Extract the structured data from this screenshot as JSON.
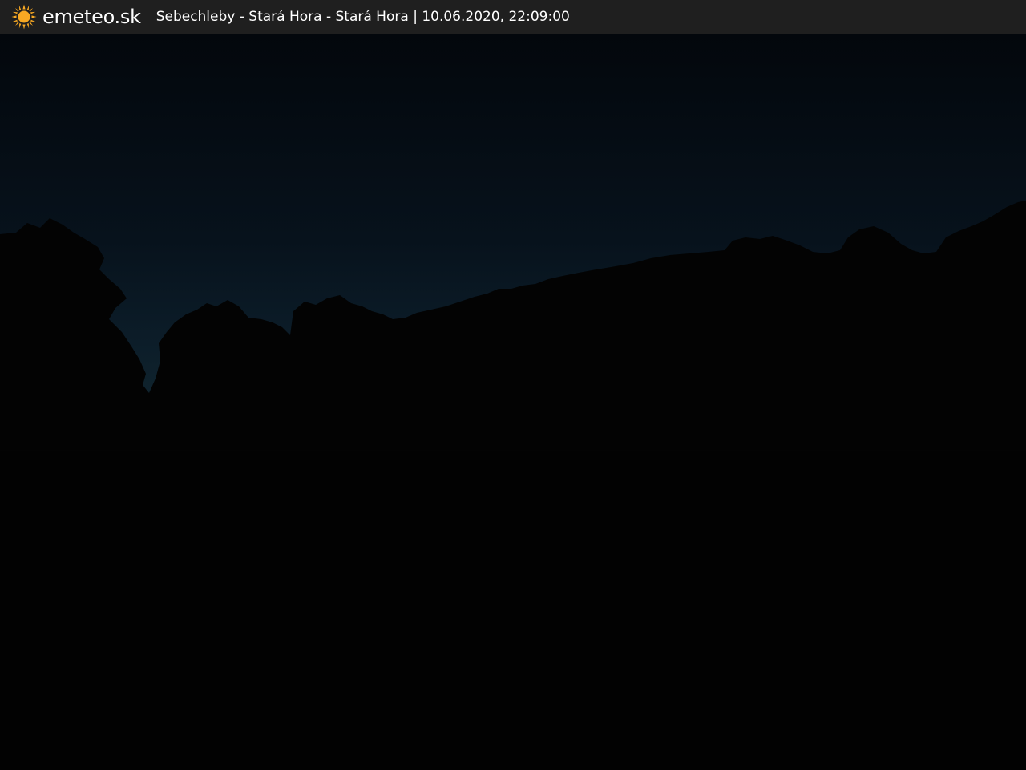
{
  "header": {
    "brand": "emeteo.sk",
    "location": "Sebechleby - Stará Hora - Stará Hora",
    "separator": "|",
    "timestamp": "10.06.2020, 22:09:00",
    "logo_icon": "sun-icon",
    "logo_color": "#f7a823"
  },
  "webcam": {
    "sky_color_top": "#03070c",
    "sky_color_horizon": "#0f2230",
    "ground_color": "#030303"
  }
}
